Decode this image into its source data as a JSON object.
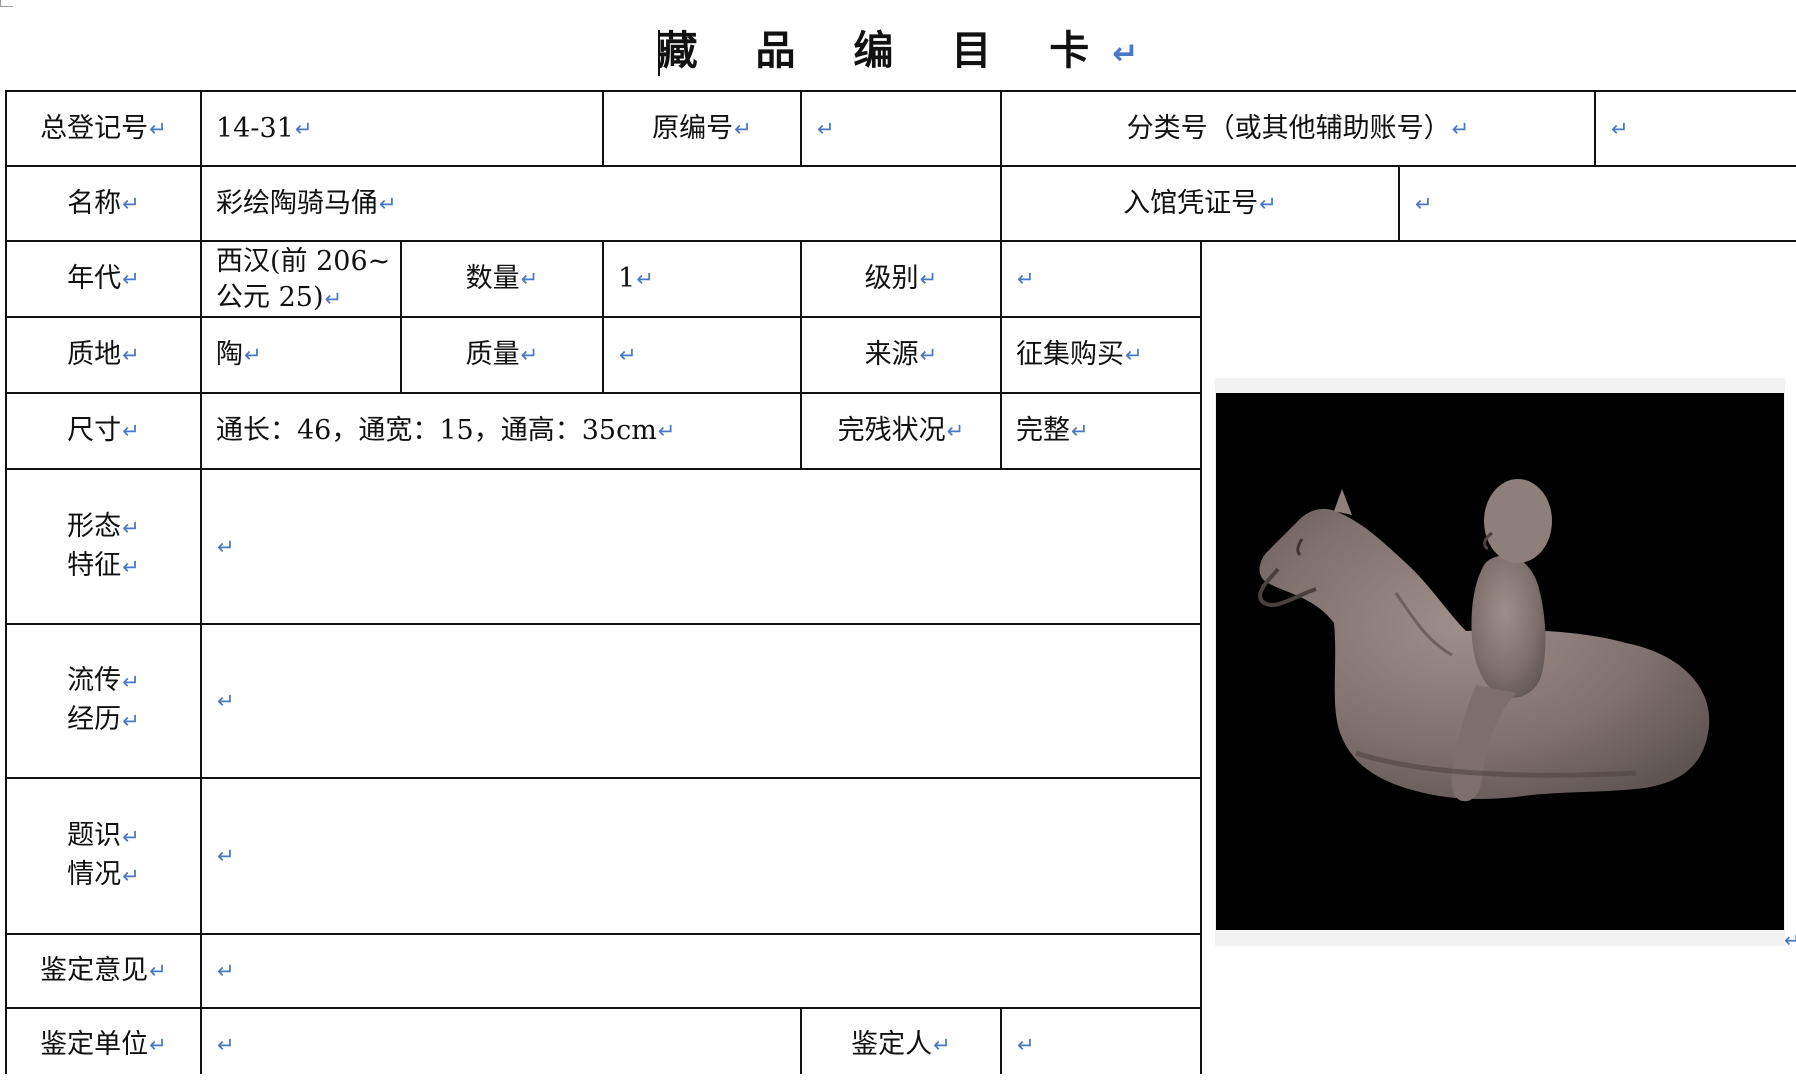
{
  "document": {
    "title": "藏 品 编 目 卡",
    "return_mark": "↵"
  },
  "card": {
    "total_reg_no_label": "总登记号",
    "total_reg_no_value": "14-31",
    "orig_no_label": "原编号",
    "orig_no_value": "",
    "class_no_label": "分类号（或其他辅助账号）",
    "class_no_value": "",
    "name_label": "名称",
    "name_value": "彩绘陶骑马俑",
    "entry_voucher_label": "入馆凭证号",
    "entry_voucher_value": "",
    "period_label": "年代",
    "period_value_line1": "西汉(前 206~",
    "period_value_line2": "公元 25)",
    "quantity_label": "数量",
    "quantity_value": "1",
    "grade_label": "级别",
    "grade_value": "",
    "material_label": "质地",
    "material_value": "陶",
    "weight_label": "质量",
    "weight_value": "",
    "source_label": "来源",
    "source_value": "征集购买",
    "size_label": "尺寸",
    "size_value": "通长：46，通宽：15，通高：35cm",
    "condition_label": "完残状况",
    "condition_value": "完整",
    "form_label_line1": "形态",
    "form_label_line2": "特征",
    "form_value": "",
    "provenance_label_line1": "流传",
    "provenance_label_line2": "经历",
    "provenance_value": "",
    "inscription_label_line1": "题识",
    "inscription_label_line2": "情况",
    "inscription_value": "",
    "appraisal_opinion_label": "鉴定意见",
    "appraisal_opinion_value": "",
    "appraisal_unit_label": "鉴定单位",
    "appraisal_unit_value": "",
    "appraiser_label": "鉴定人",
    "appraiser_value": ""
  },
  "photo": {
    "subject": "painted-pottery-horse-rider",
    "background_color": "#000000",
    "figure_color": "#8a7a76"
  },
  "colors": {
    "rule": "#111111",
    "return_mark": "#4a78c4"
  }
}
